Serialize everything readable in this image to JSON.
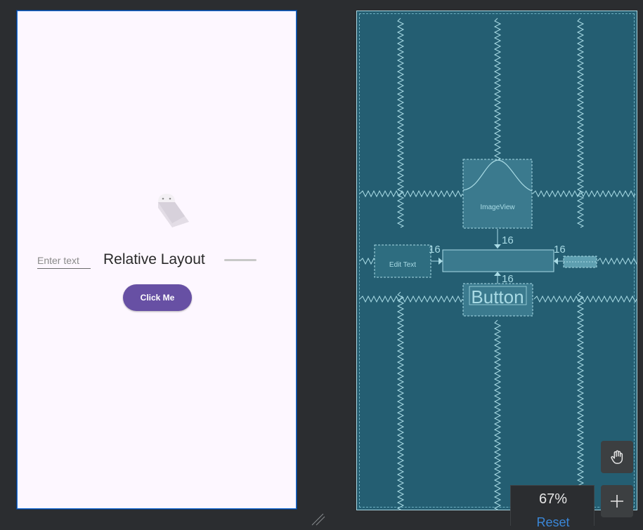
{
  "design": {
    "edit_text_hint": "Enter text",
    "title_text": "Relative Layout",
    "button_label": "Click Me"
  },
  "blueprint": {
    "image_view_label": "ImageView",
    "edit_text_label": "Edit Text",
    "button_label": "Button",
    "margins": {
      "image_bottom": "16",
      "bar_left": "16",
      "bar_right": "16",
      "button_top": "16"
    }
  },
  "controls": {
    "zoom_level": "67%",
    "reset_label": "Reset",
    "pan_icon": "hand-icon",
    "zoom_in_icon": "plus-icon"
  },
  "colors": {
    "design_background": "#fdf7ff",
    "blueprint_background": "#245e72",
    "accent_button": "#6750a4",
    "blueprint_stroke": "#a9dbe5",
    "reset_link": "#3a87d8"
  }
}
